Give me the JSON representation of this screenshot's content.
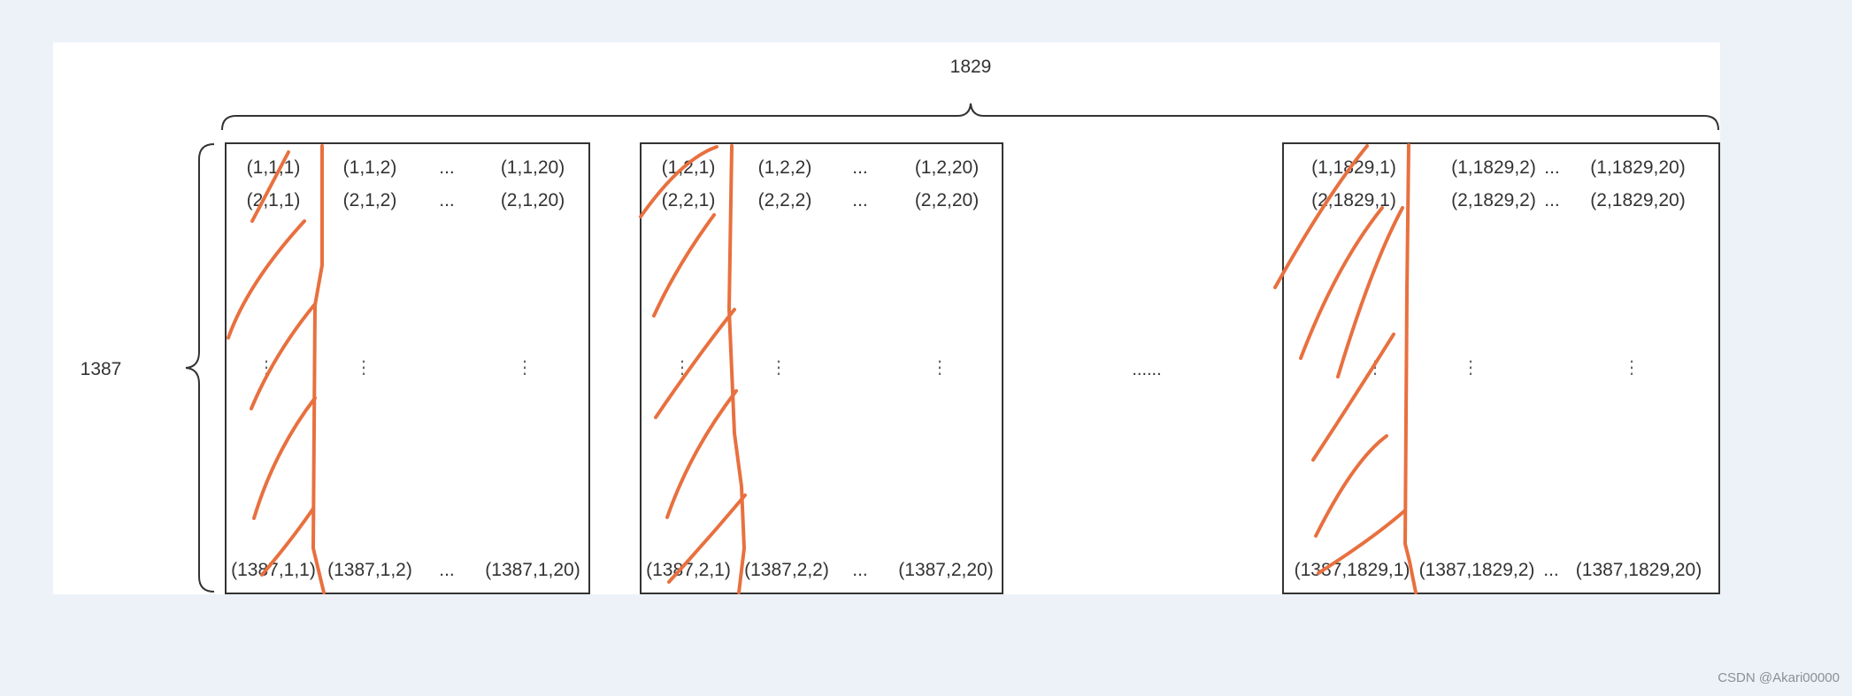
{
  "diagram": {
    "top_dimension_label": "1829",
    "left_dimension_label": "1387",
    "between_blocks_ellipsis": "......",
    "blocks": [
      {
        "name": "block-1",
        "row1": [
          "(1,1,1)",
          "(1,1,2)",
          "...",
          "(1,1,20)"
        ],
        "row2": [
          "(2,1,1)",
          "(2,1,2)",
          "...",
          "(2,1,20)"
        ],
        "vertical_dots": [
          "⋮",
          "⋮",
          "⋮"
        ],
        "last_row": [
          "(1387,1,1)",
          "(1387,1,2)",
          "...",
          "(1387,1,20)"
        ]
      },
      {
        "name": "block-2",
        "row1": [
          "(1,2,1)",
          "(1,2,2)",
          "...",
          "(1,2,20)"
        ],
        "row2": [
          "(2,2,1)",
          "(2,2,2)",
          "...",
          "(2,2,20)"
        ],
        "vertical_dots": [
          "⋮",
          "⋮",
          "⋮"
        ],
        "last_row": [
          "(1387,2,1)",
          "(1387,2,2)",
          "...",
          "(1387,2,20)"
        ]
      },
      {
        "name": "block-1829",
        "row1": [
          "(1,1829,1)",
          "(1,1829,2)",
          "...",
          "(1,1829,20)"
        ],
        "row2": [
          "(2,1829,1)",
          "(2,1829,2)",
          "...",
          "(2,1829,20)"
        ],
        "vertical_dots": [
          "⋮",
          "⋮",
          "⋮"
        ],
        "last_row": [
          "(1387,1829,1)",
          "(1387,1829,2)",
          "...",
          "(1387,1829,20)"
        ]
      }
    ],
    "annotation_color": "#e8703f",
    "line_color": "#333333"
  },
  "watermark": "CSDN @Akari00000"
}
